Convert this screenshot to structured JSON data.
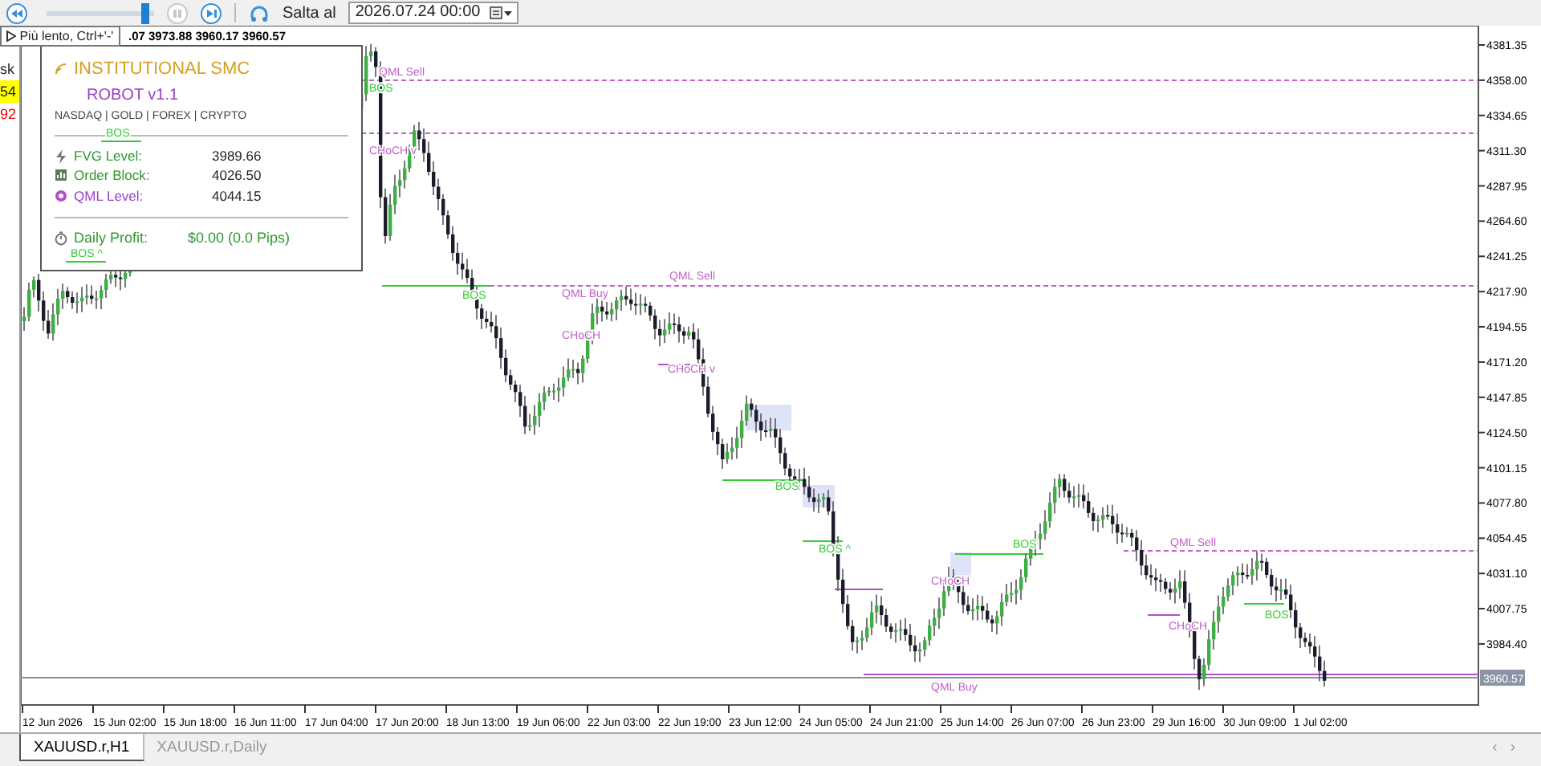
{
  "toolbar": {
    "speed": {
      "level": 0.95
    },
    "jump_label": "Salta al",
    "date_field": "2026.07.24 00:00"
  },
  "tooltip": "Più lento, Ctrl+'-'",
  "market_watch": [
    {
      "kind": "header",
      "text": "sk"
    },
    {
      "kind": "up",
      "text": "54"
    },
    {
      "kind": "down",
      "text": "92"
    }
  ],
  "chart": {
    "ohlc": ".07 3973.88 3960.17 3960.57",
    "price_labels": [
      "4381.35",
      "4358.00",
      "4334.65",
      "4311.30",
      "4287.95",
      "4264.60",
      "4241.25",
      "4217.90",
      "4194.55",
      "4171.20",
      "4147.85",
      "4124.50",
      "4101.15",
      "4077.80",
      "4054.45",
      "4031.10",
      "4007.75",
      "3984.40"
    ],
    "current_price": "3960.57",
    "time_labels": [
      "12 Jun 2026",
      "15 Jun 02:00",
      "15 Jun 18:00",
      "16 Jun 11:00",
      "17 Jun 04:00",
      "17 Jun 20:00",
      "18 Jun 13:00",
      "19 Jun 06:00",
      "22 Jun 03:00",
      "22 Jun 19:00",
      "23 Jun 12:00",
      "24 Jun 05:00",
      "24 Jun 21:00",
      "25 Jun 14:00",
      "26 Jun 07:00",
      "26 Jun 23:00",
      "29 Jun 16:00",
      "30 Jun 09:00",
      "1 Jul 02:00"
    ],
    "annotations": [
      {
        "kind": "qml",
        "text": "QML Sell"
      },
      {
        "kind": "bos",
        "text": "BOS"
      },
      {
        "kind": "choch",
        "text": "CHoCH v"
      },
      {
        "kind": "bos",
        "text": "BOS"
      },
      {
        "kind": "qml",
        "text": "QML Sell"
      },
      {
        "kind": "qml",
        "text": "QML Buy"
      },
      {
        "kind": "choch",
        "text": "CHoCH"
      },
      {
        "kind": "choch",
        "text": "CHoCH v"
      },
      {
        "kind": "bos",
        "text": "BOS"
      },
      {
        "kind": "bos",
        "text": "BOS ^"
      },
      {
        "kind": "choch",
        "text": "CHoCH"
      },
      {
        "kind": "bos",
        "text": "BOS"
      },
      {
        "kind": "qml",
        "text": "QML Sell"
      },
      {
        "kind": "choch",
        "text": "CHoCH"
      },
      {
        "kind": "bos",
        "text": "BOS"
      },
      {
        "kind": "qml",
        "text": "QML Buy"
      },
      {
        "kind": "bos",
        "text": "BOS"
      },
      {
        "kind": "bos",
        "text": "BOS ^"
      }
    ]
  },
  "panel": {
    "title": "INSTITUTIONAL SMC",
    "subtitle": "ROBOT v1.1",
    "markets": "NASDAQ | GOLD | FOREX | CRYPTO",
    "levels": [
      {
        "kind": "fvg",
        "label": "FVG Level:",
        "value": "3989.66"
      },
      {
        "kind": "order_block",
        "label": "Order Block:",
        "value": "4026.50"
      },
      {
        "kind": "qml",
        "label": "QML Level:",
        "value": "4044.15"
      }
    ],
    "profit_label": "Daily Profit:",
    "profit_value": "$0.00 (0.0 Pips)"
  },
  "tabs": [
    {
      "label": "XAUUSD.r,H1",
      "selected": true
    },
    {
      "label": "XAUUSD.r,Daily",
      "selected": false
    }
  ],
  "tab_scroll": [
    "‹",
    "›"
  ]
}
